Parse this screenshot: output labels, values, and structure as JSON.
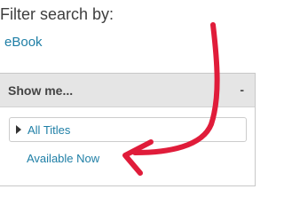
{
  "filter": {
    "heading": "Filter search by:",
    "format_link": "eBook"
  },
  "panel": {
    "title": "Show me...",
    "toggle": "-",
    "options": [
      {
        "label": "All Titles"
      },
      {
        "label": "Available Now"
      }
    ]
  },
  "annotation": {
    "arrow_color": "#e01c3a"
  },
  "colors": {
    "link": "#1f7fa6",
    "panel_header_bg": "#e5e5e5",
    "heading_text": "#3e3e3e"
  },
  "icons": {
    "expand_caret": "caret-right-icon"
  }
}
